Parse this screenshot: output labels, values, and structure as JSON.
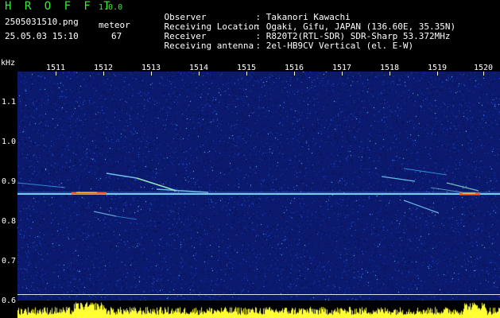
{
  "header": {
    "app_title": "H R O F F T",
    "app_version": "1.0.0",
    "file_name": "2505031510.png",
    "date_time": "25.05.03 15:10",
    "meteor_label": "meteor",
    "meteor_count": "67",
    "info": [
      {
        "key": "Observer",
        "value": ": Takanori Kawachi"
      },
      {
        "key": "Receiving Location",
        "value": ": Ogaki, Gifu, JAPAN (136.60E, 35.35N)"
      },
      {
        "key": "Receiver",
        "value": ": R820T2(RTL-SDR) SDR-Sharp 53.372MHz"
      },
      {
        "key": "Receiving antenna",
        "value": ": 2el-HB9CV Vertical (el. E-W)"
      }
    ]
  },
  "axes": {
    "y_unit": "kHz",
    "y_ticks": [
      "1.1",
      "1.0",
      "0.9",
      "0.8",
      "0.7",
      "0.6"
    ],
    "x_ticks": [
      "1511",
      "1512",
      "1513",
      "1514",
      "1515",
      "1516",
      "1517",
      "1518",
      "1519",
      "1520"
    ]
  },
  "colors": {
    "title_green": "#35f035",
    "background": "#0b1a6e",
    "carrier": "#7fe0ff",
    "hot": "#ff5a2a",
    "power_bars": "#ffff33"
  }
}
